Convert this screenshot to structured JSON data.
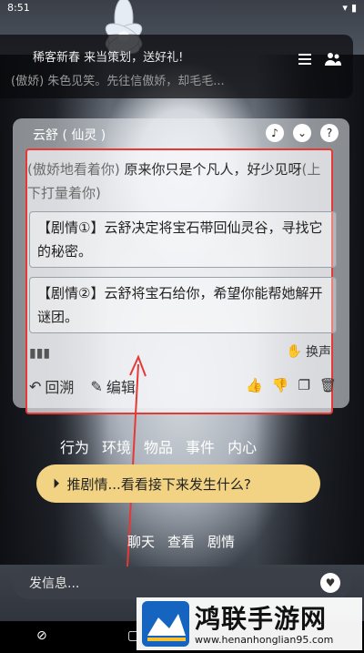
{
  "status": {
    "time": "8:51"
  },
  "banner": {
    "line1": "稀客新春 来当策划，送好礼!",
    "line2": "(傲娇) 朱色见笑。先往信傲娇，却毛毛..."
  },
  "character": {
    "name": "云舒 ( 仙灵 )"
  },
  "message": {
    "action1": "(傲娇地看着你)",
    "text1": " 原来你只是个凡人，好少见呀",
    "action2": "(上下打量着你)"
  },
  "options": [
    {
      "label": "【剧情①】云舒决定将宝石带回仙灵谷，寻找它的秘密。"
    },
    {
      "label": "【剧情②】云舒将宝石给你，希望你能帮她解开谜团。"
    }
  ],
  "card_controls": {
    "switch_voice": "换声",
    "rewind": "回溯",
    "edit": "编辑"
  },
  "categories": [
    "行为",
    "环境",
    "物品",
    "事件",
    "内心"
  ],
  "push_story": {
    "label": "推剧情...看看接下来发生什么?"
  },
  "bottom_tabs": [
    "聊天",
    "查看",
    "剧情"
  ],
  "input": {
    "placeholder": "发信息..."
  },
  "watermark": {
    "title": "鸿联手游网",
    "url": "www.henanhonglian95.com"
  },
  "colors": {
    "highlight": "#e53935",
    "push_button": "#f1d383"
  }
}
